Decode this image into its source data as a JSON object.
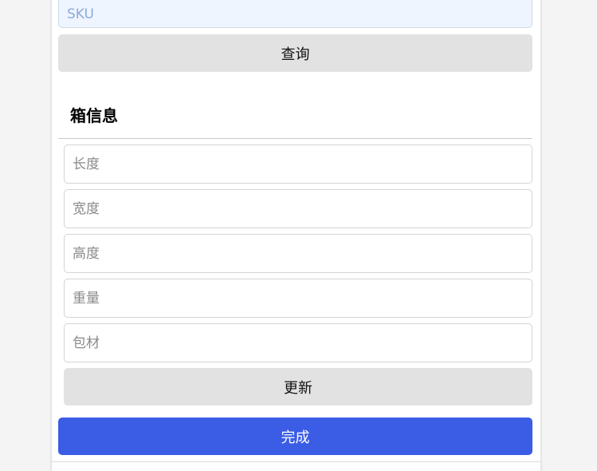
{
  "search": {
    "sku_placeholder": "SKU",
    "sku_value": "",
    "query_label": "查询"
  },
  "box_info": {
    "title": "箱信息",
    "fields": {
      "length_placeholder": "长度",
      "width_placeholder": "宽度",
      "height_placeholder": "高度",
      "weight_placeholder": "重量",
      "packaging_placeholder": "包材"
    },
    "update_label": "更新"
  },
  "footer": {
    "done_label": "完成"
  },
  "colors": {
    "primary": "#3b5ce4",
    "secondary_button": "#e2e2e2",
    "sku_input_bg": "#eef5ff"
  }
}
